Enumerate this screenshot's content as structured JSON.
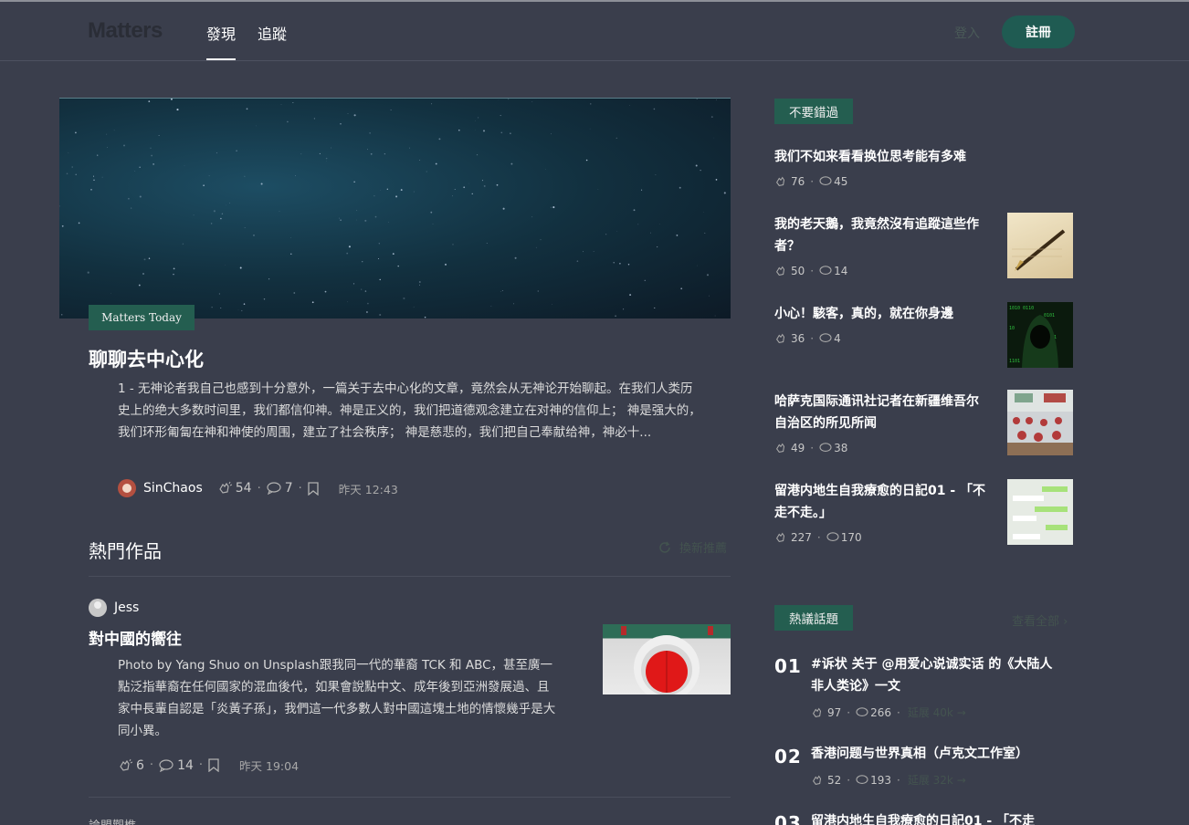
{
  "header": {
    "logo": "Matters",
    "tabs": [
      {
        "label": "發現",
        "active": true
      },
      {
        "label": "追蹤",
        "active": false
      }
    ],
    "login_label": "登入",
    "signup_label": "註冊"
  },
  "hero": {
    "badge": "Matters Today",
    "title": "聊聊去中心化",
    "summary": "1 - 无神论者我自己也感到十分意外，一篇关于去中心化的文章，竟然会从无神论开始聊起。在我们人类历史上的绝大多数时间里，我们都信仰神。神是正义的，我们把道德观念建立在对神的信仰上； 神是强大的，我们环形匍匐在神和神使的周围，建立了社会秩序； 神是慈悲的，我们把自己奉献给神，神必十...",
    "author": "SinChaos",
    "claps": "54",
    "comments": "7",
    "time": "昨天 12:43"
  },
  "hot": {
    "title": "熱門作品",
    "refresh_label": "換新推薦",
    "items": [
      {
        "author": "Jess",
        "title": "對中國的嚮往",
        "summary": "Photo by Yang Shuo on Unsplash跟我同一代的華裔 TCK 和 ABC，甚至廣一點泛指華裔在任何國家的混血後代，如果會說點中文、成年後到亞洲發展過、且家中長輩自認是「炎黃子孫」，我們這一代多數人對中國這塊土地的情懷幾乎是大同小異。",
        "claps": "6",
        "comments": "14",
        "time": "昨天 19:04"
      }
    ],
    "next_author": "論盟觀樵"
  },
  "sidebar": {
    "dont_miss": {
      "tag": "不要錯過",
      "items": [
        {
          "title": "我们不如来看看换位思考能有多难",
          "claps": "76",
          "comments": "45"
        },
        {
          "title": "我的老天鵝，我竟然沒有追蹤這些作者？",
          "claps": "50",
          "comments": "14"
        },
        {
          "title": "小心！駭客，真的，就在你身邊",
          "claps": "36",
          "comments": "4"
        },
        {
          "title": "哈萨克国际通讯社记者在新疆维吾尔自治区的所见所闻",
          "claps": "49",
          "comments": "38"
        },
        {
          "title": "留港内地生自我療愈的日記01 - 「不走不走。」",
          "claps": "227",
          "comments": "170"
        }
      ]
    },
    "topics": {
      "tag": "熱議話題",
      "view_all": "查看全部 ›",
      "items": [
        {
          "rank": "01",
          "title": "#诉状 关于 @用爱心说诚实话 的《大陆人非人类论》一文",
          "claps": "97",
          "comments": "266",
          "extra": "延展 40k →"
        },
        {
          "rank": "02",
          "title": "香港问题与世界真相（卢克文工作室）",
          "claps": "52",
          "comments": "193",
          "extra": "延展 32k →"
        },
        {
          "rank": "03",
          "title": "留港内地生自我療愈的日記01 - 「不走"
        }
      ]
    }
  },
  "colors": {
    "background": "#3a3e4c",
    "accent": "#245e50",
    "signup": "#1f5b52"
  }
}
